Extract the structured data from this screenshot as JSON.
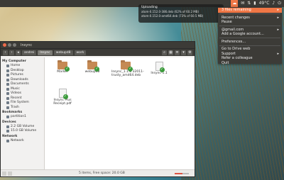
{
  "notification": {
    "title": "Uploading",
    "lines": [
      "atom-0.152.0-386.deb (62% of 60.2 MB)",
      "atom-0.152.0-amd64.deb (73% of 60.5 MB)"
    ]
  },
  "tray": {
    "temp": "49°C"
  },
  "menu": {
    "items": [
      {
        "label": "3 files remaining",
        "active": true,
        "arrow": true
      },
      {
        "label": "Recent changes",
        "arrow": true
      },
      {
        "label": "Pause"
      },
      {
        "label": "@gmail.com",
        "arrow": true
      },
      {
        "label": "Add a Google account..."
      },
      {
        "label": "Preferences..."
      },
      {
        "label": "Go to Drive web"
      },
      {
        "label": "Support",
        "arrow": true
      },
      {
        "label": "Refer a colleague"
      },
      {
        "label": "Quit"
      }
    ]
  },
  "window": {
    "title": "Insync",
    "breadcrumbs": [
      "andrei",
      "Insync",
      "webupd8",
      "work"
    ],
    "sidebar": {
      "sections": [
        {
          "header": "My Computer",
          "items": [
            "Home",
            "Desktop",
            "Pictures",
            "Downloads",
            "Documents",
            "Music",
            "Videos",
            "Recent",
            "File System",
            "Trash"
          ]
        },
        {
          "header": "Bookmarks",
          "items": [
            "partition1"
          ]
        },
        {
          "header": "Devices",
          "items": [
            "2.2 GB Volume",
            "15.0 GB Volume"
          ]
        },
        {
          "header": "Network",
          "items": [
            "Network"
          ]
        }
      ]
    },
    "files": [
      {
        "name": "Marker",
        "type": "folder"
      },
      {
        "name": "webupd8",
        "type": "folder"
      },
      {
        "name": "Insync_1.1.2.32011-trusty_amd64.deb",
        "type": "folder"
      },
      {
        "name": "Insync-1.1",
        "type": "doc"
      },
      {
        "name": "Insync Plus Receipt.pdf",
        "type": "doc"
      }
    ],
    "status": "5 items, Free space: 20.0 GB"
  }
}
